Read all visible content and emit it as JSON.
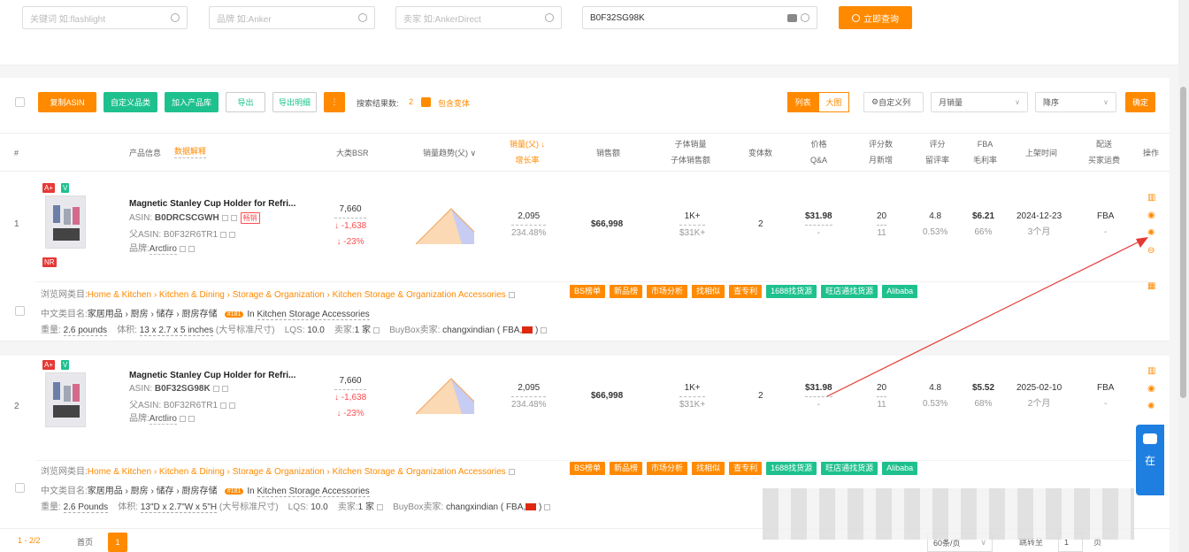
{
  "search": {
    "keyword_placeholder": "关键词 如:flashlight",
    "brand_placeholder": "品牌 如:Anker",
    "seller_placeholder": "卖家 如:AnkerDirect",
    "asin_value": "B0F32SG98K",
    "search_button": "立即查询"
  },
  "toolbar": {
    "copy_asin": "复制ASIN",
    "custom_category": "自定义品类",
    "add_to_library": "加入产品库",
    "export": "导出",
    "export_detail": "导出明细",
    "more": "⋮",
    "result_count_label": "搜索结果数:",
    "result_count": "2",
    "include_variants": "包含变体",
    "view_list": "列表",
    "view_grid": "大图",
    "custom_columns": "自定义列",
    "sort_field": "月销量",
    "sort_order": "降序",
    "confirm": "确定"
  },
  "headers": {
    "index": "#",
    "product_info": "产品信息",
    "data_explain": "数据解释",
    "bsr": "大类BSR",
    "trend": "销量趋势(父)",
    "sales": "销量(父)",
    "growth": "增长率",
    "revenue": "销售额",
    "child_sales": "子体销量",
    "child_revenue": "子体销售额",
    "variants": "变体数",
    "price": "价格",
    "qa": "Q&A",
    "reviews": "评分数",
    "monthly_new": "月新增",
    "rating": "评分",
    "leave_rate": "留评率",
    "fba": "FBA",
    "margin": "毛利率",
    "listing_time": "上架时间",
    "delivery": "配送",
    "buyer_freight": "买家运费",
    "actions": "操作"
  },
  "rows": [
    {
      "index": "1",
      "title": "Magnetic Stanley Cup Holder for Refri...",
      "asin_label": "ASIN:",
      "asin": "B0DRCSCGWH",
      "asin_tag": "畅销",
      "parent_asin_label": "父ASIN:",
      "parent_asin": "B0F32R6TR1",
      "brand_label": "品牌:",
      "brand": "Arctliro",
      "badge_a": "A+",
      "badge_v": "V",
      "badge_nr": "NR",
      "bsr": "7,660",
      "bsr_change": "↓ -1,638",
      "bsr_pct": "↓ -23%",
      "sales": "2,095",
      "growth": "234.48%",
      "revenue": "$66,998",
      "child_sales": "1K+",
      "child_revenue": "$31K+",
      "variants": "2",
      "price": "$31.98",
      "qa": "-",
      "reviews": "20",
      "monthly_new": "11",
      "rating": "4.8",
      "leave_rate": "0.53%",
      "fba": "$6.21",
      "margin": "66%",
      "listing_date": "2024-12-23",
      "listing_age": "3个月",
      "delivery": "FBA",
      "freight": "-",
      "category_label": "浏览网类目:",
      "category_path": "Home & Kitchen › Kitchen & Dining › Storage & Organization › Kitchen Storage & Organization Accessories",
      "cn_category_label": "中文类目名:",
      "cn_category": "家居用品 › 厨房 › 储存 › 厨房存储",
      "rank": "#181",
      "rank_in": "In",
      "rank_category": "Kitchen Storage Accessories",
      "weight_label": "重量:",
      "weight": "2.6 pounds",
      "volume_label": "体积:",
      "volume": "13 x 2.7 x 5 inches",
      "size_class": "(大号标准尺寸)",
      "lqs_label": "LQS:",
      "lqs": "10.0",
      "sellers_label": "卖家:",
      "sellers": "1 家",
      "buybox_label": "BuyBox卖家:",
      "buybox": "changxindian ( FBA,",
      "buybox_end": ")"
    },
    {
      "index": "2",
      "title": "Magnetic Stanley Cup Holder for Refri...",
      "asin_label": "ASIN:",
      "asin": "B0F32SG98K",
      "asin_tag": "",
      "parent_asin_label": "父ASIN:",
      "parent_asin": "B0F32R6TR1",
      "brand_label": "品牌:",
      "brand": "Arctliro",
      "badge_a": "A+",
      "badge_v": "V",
      "badge_nr": "",
      "bsr": "7,660",
      "bsr_change": "↓ -1,638",
      "bsr_pct": "↓ -23%",
      "sales": "2,095",
      "growth": "234.48%",
      "revenue": "$66,998",
      "child_sales": "1K+",
      "child_revenue": "$31K+",
      "variants": "2",
      "price": "$31.98",
      "qa": "-",
      "reviews": "20",
      "monthly_new": "11",
      "rating": "4.8",
      "leave_rate": "0.53%",
      "fba": "$5.52",
      "margin": "68%",
      "listing_date": "2025-02-10",
      "listing_age": "2个月",
      "delivery": "FBA",
      "freight": "-",
      "category_label": "浏览网类目:",
      "category_path": "Home & Kitchen › Kitchen & Dining › Storage & Organization › Kitchen Storage & Organization Accessories",
      "cn_category_label": "中文类目名:",
      "cn_category": "家居用品 › 厨房 › 储存 › 厨房存储",
      "rank": "#181",
      "rank_in": "In",
      "rank_category": "Kitchen Storage Accessories",
      "weight_label": "重量:",
      "weight": "2.6 Pounds",
      "volume_label": "体积:",
      "volume": "13\"D x 2.7\"W x 5\"H",
      "size_class": "(大号标准尺寸)",
      "lqs_label": "LQS:",
      "lqs": "10.0",
      "sellers_label": "卖家:",
      "sellers": "1 家",
      "buybox_label": "BuyBox卖家:",
      "buybox": "changxindian ( FBA,",
      "buybox_end": ")"
    }
  ],
  "action_tags": [
    "BS榜单",
    "新品榜",
    "市场分析",
    "找相似",
    "查专利",
    "1688找货源",
    "旺店通找货源",
    "Alibaba"
  ],
  "pager": {
    "range": "1 - 2/2",
    "first": "首页",
    "current": "1",
    "per_page": "60条/页",
    "jump_to": "跳转至",
    "jump_value": "1",
    "page_suffix": "页"
  },
  "float_chat": {
    "label": "在"
  },
  "colors": {
    "accent": "#ff8a00",
    "green": "#1ec18d",
    "red": "#ff4d4f"
  }
}
